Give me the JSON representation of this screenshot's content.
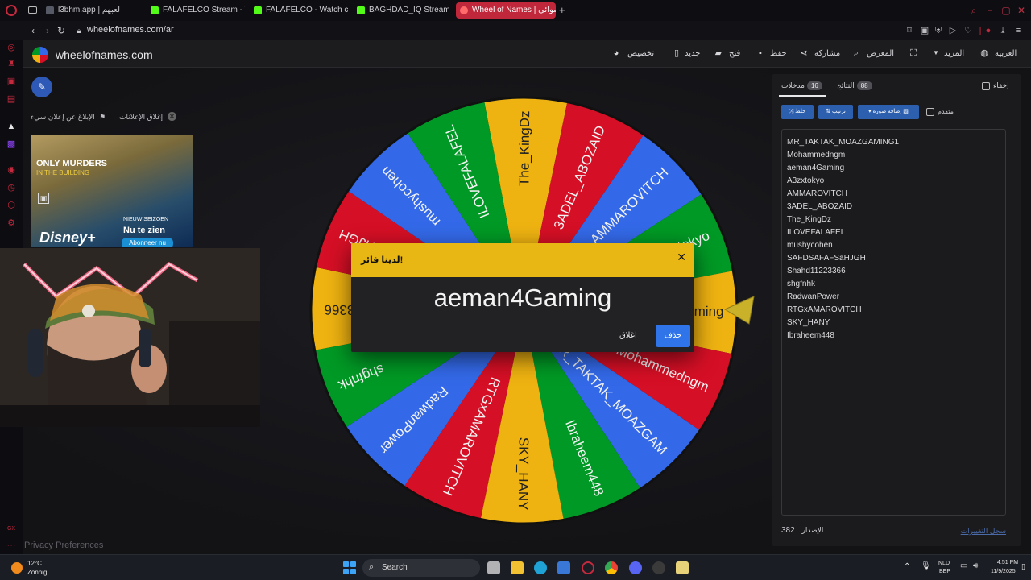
{
  "browser": {
    "tabs": [
      {
        "label": "l3bhm.app | لعبهم",
        "favicon_color": "#555a66",
        "active": false
      },
      {
        "label": "FALAFELCO Stream - Wat",
        "favicon_color": "#53fc18",
        "active": false
      },
      {
        "label": "FALAFELCO - Watch clips",
        "favicon_color": "#53fc18",
        "active": false
      },
      {
        "label": "BAGHDAD_IQ Stream - W",
        "favicon_color": "#53fc18",
        "active": false
      },
      {
        "label": "Wheel of Names | عشوائي",
        "favicon_color": "#ff6b6b",
        "active": true
      }
    ],
    "new_tab_label": "+",
    "url": "wheelofnames.com/ar"
  },
  "site": {
    "name": "wheelofnames.com",
    "menu": {
      "customize": "تخصيص",
      "new": "جديد",
      "open": "فتح",
      "save": "حفظ",
      "share": "مشاركة",
      "gallery": "المعرض",
      "more": "المزيد",
      "language": "العربية"
    }
  },
  "ads": {
    "close_ads": "إغلاق الإعلانات",
    "report_ad": "الإبلاغ عن إعلان سيء",
    "ad_title_line1": "ONLY MURDERS",
    "ad_title_line2": "IN THE BUILDING",
    "ad_new_season": "NIEUW SEIZOEN",
    "ad_now_showing": "Nu te zien",
    "ad_subscribe": "Abonneer nu",
    "ad_brand": "Disney+"
  },
  "privacy_link": "Privacy Preferences",
  "wheel": {
    "segments": [
      {
        "label": "The_KingDz",
        "color": "#eeb211"
      },
      {
        "label": "3ADEL_ABOZAID",
        "color": "#d50f25"
      },
      {
        "label": "AMMAROVITCH",
        "color": "#3369e8"
      },
      {
        "label": "A3zxtokyo",
        "color": "#009925"
      },
      {
        "label": "aeman4Gaming",
        "color": "#eeb211"
      },
      {
        "label": "Mohammedngm",
        "color": "#d50f25"
      },
      {
        "label": "MR_TAKTAK_MOAZGAM",
        "color": "#3369e8"
      },
      {
        "label": "Ibraheem448",
        "color": "#009925"
      },
      {
        "label": "SKY_HANY",
        "color": "#eeb211"
      },
      {
        "label": "RTGxAMAROVITCH",
        "color": "#d50f25"
      },
      {
        "label": "RadwanPower",
        "color": "#3369e8"
      },
      {
        "label": "shgfnhk",
        "color": "#009925"
      },
      {
        "label": "Shahd11223366",
        "color": "#eeb211"
      },
      {
        "label": "SAFDSAFAFSaHJGH",
        "color": "#d50f25"
      },
      {
        "label": "mushycohen",
        "color": "#3369e8"
      },
      {
        "label": "ILOVEFALAFEL",
        "color": "#009925"
      }
    ],
    "pointer_color": "#c9b12a"
  },
  "dialog": {
    "title": "لدينا فائز!",
    "winner": "aeman4Gaming",
    "remove_button": "حذف",
    "close_button": "اغلاق"
  },
  "panel": {
    "hide_label": "إخفاء",
    "tab_entries": "مدخلات",
    "tab_entries_count": "16",
    "tab_results": "النتائج",
    "tab_results_count": "88",
    "shuffle_button": "خلط",
    "sort_button": "ترتيب",
    "add_image_button": "إضافة صورة",
    "advanced_label": "متقدم",
    "entries": [
      "MR_TAKTAK_MOAZGAMING1",
      "Mohammedngm",
      "aeman4Gaming",
      "A3zxtokyo",
      "AMMAROVITCH",
      "3ADEL_ABOZAID",
      "The_KingDz",
      "ILOVEFALAFEL",
      "mushycohen",
      "SAFDSAFAFSaHJGH",
      "Shahd11223366",
      "shgfnhk",
      "RadwanPower",
      "RTGxAMAROVITCH",
      "SKY_HANY",
      "Ibraheem448"
    ],
    "version_label": "الإصدار",
    "version_number": "382",
    "changelog": "سجل التغييرات"
  },
  "taskbar": {
    "temperature": "12°C",
    "condition": "Zonnig",
    "search_placeholder": "Search",
    "lang_top": "NLD",
    "lang_bottom": "BEP",
    "time": "4:51 PM",
    "date": "11/9/2025"
  }
}
